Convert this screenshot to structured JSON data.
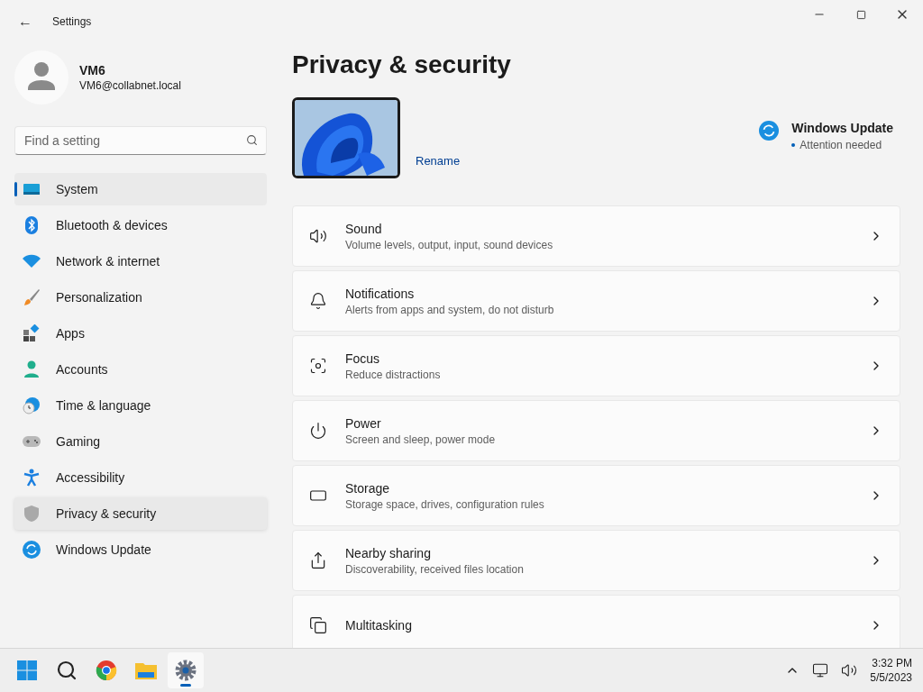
{
  "window": {
    "title": "Settings",
    "back": "←"
  },
  "account": {
    "name": "VM6",
    "email": "VM6@collabnet.local"
  },
  "search": {
    "placeholder": "Find a setting"
  },
  "sidebar": {
    "items": [
      {
        "label": "System",
        "selected": true,
        "hovered": false
      },
      {
        "label": "Bluetooth & devices",
        "selected": false,
        "hovered": false
      },
      {
        "label": "Network & internet",
        "selected": false,
        "hovered": false
      },
      {
        "label": "Personalization",
        "selected": false,
        "hovered": false
      },
      {
        "label": "Apps",
        "selected": false,
        "hovered": false
      },
      {
        "label": "Accounts",
        "selected": false,
        "hovered": false
      },
      {
        "label": "Time & language",
        "selected": false,
        "hovered": false
      },
      {
        "label": "Gaming",
        "selected": false,
        "hovered": false
      },
      {
        "label": "Accessibility",
        "selected": false,
        "hovered": false
      },
      {
        "label": "Privacy & security",
        "selected": false,
        "hovered": true
      },
      {
        "label": "Windows Update",
        "selected": false,
        "hovered": false
      }
    ]
  },
  "page": {
    "title": "Privacy & security",
    "rename": "Rename",
    "update": {
      "title": "Windows Update",
      "status": "Attention needed"
    }
  },
  "cards": [
    {
      "title": "Sound",
      "description": "Volume levels, output, input, sound devices"
    },
    {
      "title": "Notifications",
      "description": "Alerts from apps and system, do not disturb"
    },
    {
      "title": "Focus",
      "description": "Reduce distractions"
    },
    {
      "title": "Power",
      "description": "Screen and sleep, power mode"
    },
    {
      "title": "Storage",
      "description": "Storage space, drives, configuration rules"
    },
    {
      "title": "Nearby sharing",
      "description": "Discoverability, received files location"
    },
    {
      "title": "Multitasking"
    }
  ],
  "taskbar": {
    "apps": [
      {
        "active": false
      },
      {
        "active": false
      },
      {
        "active": false
      },
      {
        "active": false
      },
      {
        "active": true
      }
    ],
    "time": "3:32 PM",
    "date": "5/5/2023"
  }
}
